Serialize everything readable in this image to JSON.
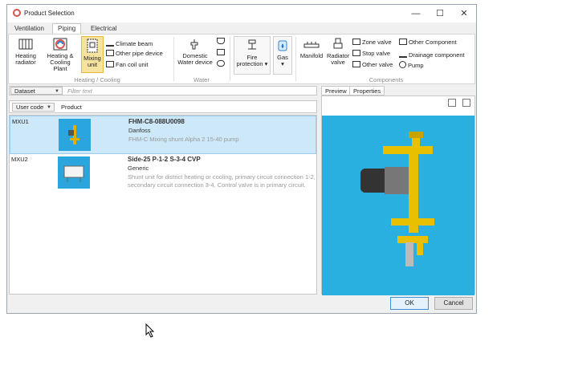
{
  "window": {
    "title": "Product Selection",
    "controls": {
      "minimize": "—",
      "maximize": "☐",
      "close": "✕"
    }
  },
  "tabs": [
    "Ventilation",
    "Piping",
    "Electrical"
  ],
  "active_tab": "Piping",
  "ribbon": {
    "heating_cooling": {
      "heating_radiator": "Heating radiator",
      "heating_cooling_plant": "Heating & Cooling Plant",
      "mixing_unit": "Mixing unit",
      "climate_beam": "Climate beam",
      "other_pipe_device": "Other pipe device",
      "fan_coil_unit": "Fan coil unit",
      "label": "Heating / Cooling"
    },
    "water": {
      "domestic_water_device": "Domestic Water device",
      "label": "Water"
    },
    "fire_protection": "Fire protection",
    "gas": "Gas",
    "components": {
      "manifold": "Manifold",
      "radiator_valve": "Radiator valve",
      "zone_valve": "Zone valve",
      "stop_valve": "Stop valve",
      "other_valve": "Other valve",
      "other_component": "Other Component",
      "drainage_component": "Drainage component",
      "pump": "Pump",
      "label": "Components"
    }
  },
  "filter": {
    "dataset": "Dataset",
    "placeholder": "Filter text"
  },
  "columns": {
    "user_code": "User code",
    "product": "Product"
  },
  "products": [
    {
      "code": "MXU1",
      "name": "FHM-C8-088U0098",
      "manufacturer": "Danfoss",
      "description": "FHM-C Mixing shunt Alpha 2 15-40 pump"
    },
    {
      "code": "MXU2",
      "name": "Side-25 P-1-2 S-3-4 CVP",
      "manufacturer": "Generic",
      "description": "Shunt unit for district heating or cooling, primary circuit connection 1-2, secondary circuit connection 3-4. Control valve is in primary circuit."
    }
  ],
  "right_tabs": [
    "Preview",
    "Properties"
  ],
  "buttons": {
    "ok": "OK",
    "cancel": "Cancel"
  },
  "colors": {
    "preview_bg": "#2ab0e0",
    "selected_row": "#cde8f8",
    "selected_tool": "#f7e3a0"
  }
}
